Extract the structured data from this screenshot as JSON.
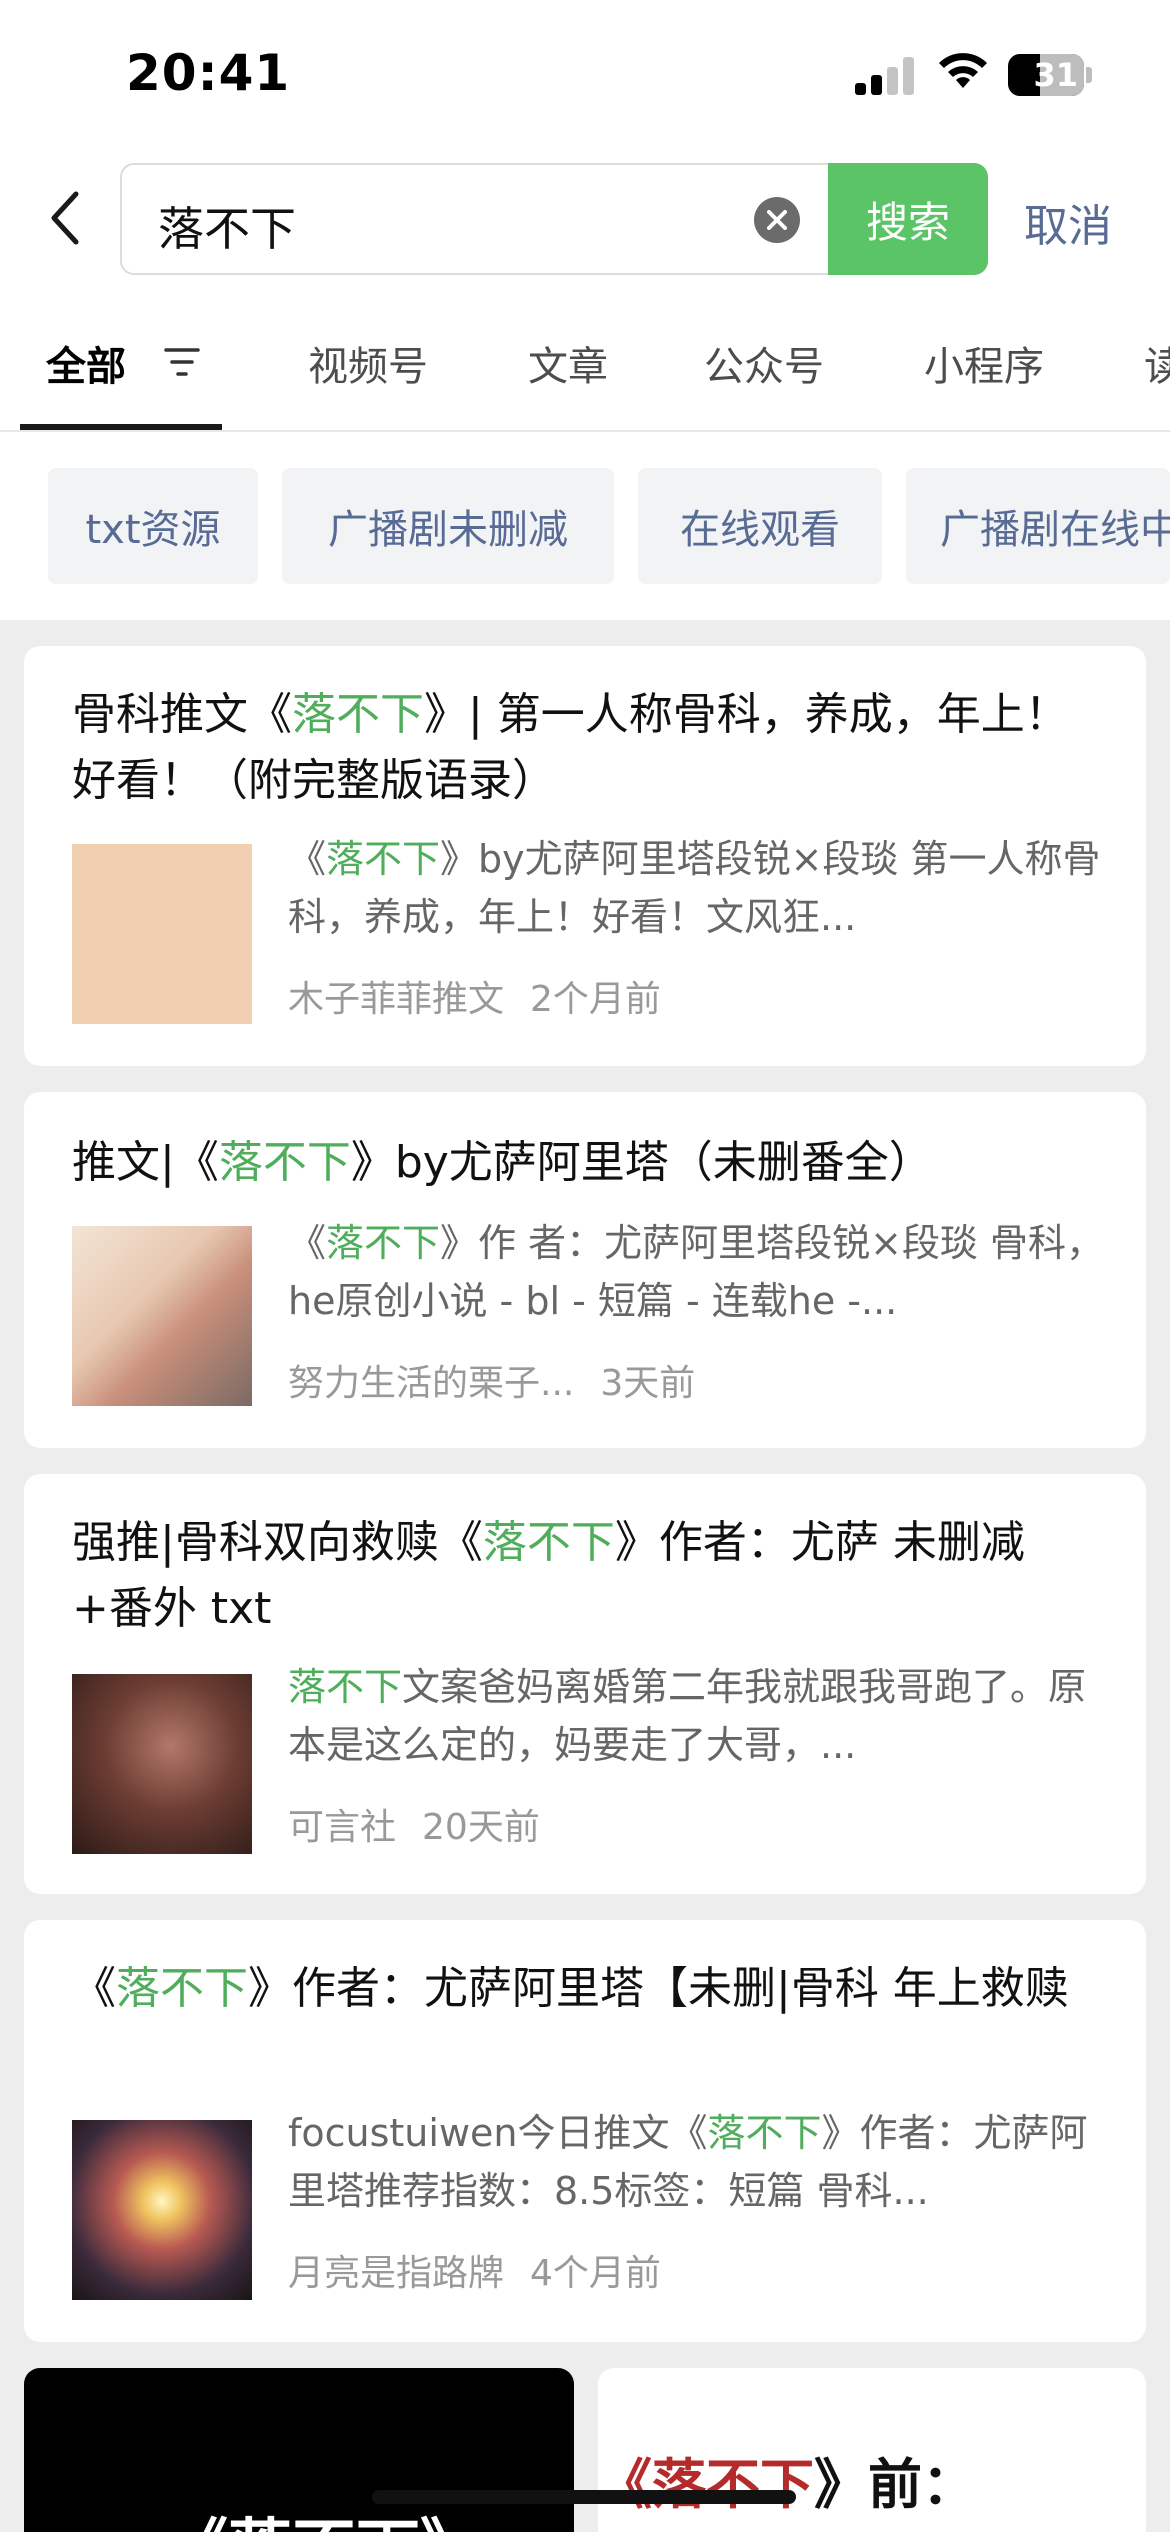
{
  "status_bar": {
    "time": "20:41",
    "battery": "31"
  },
  "search": {
    "query": "落不下",
    "button": "搜索",
    "cancel": "取消"
  },
  "tabs": [
    "全部",
    "视频号",
    "文章",
    "公众号",
    "小程序",
    "读"
  ],
  "chips": [
    "txt资源",
    "广播剧未删减",
    "在线观看",
    "广播剧在线中"
  ],
  "results": [
    {
      "title_pre": "骨科推文《",
      "title_hl": "落不下",
      "title_post": "》| 第一人称骨科，养成，年上！好看！（附完整版语录）",
      "snippet_pre": "《",
      "snippet_hl": "落不下",
      "snippet_post": "》by尤萨阿里塔段锐×段琰 第一人称骨科，养成，年上！好看！文风狂...",
      "source": "木子菲菲推文",
      "time": "2个月前",
      "thumb_color": "#f1d0b2"
    },
    {
      "title_pre": "推文|《",
      "title_hl": "落不下",
      "title_post": "》by尤萨阿里塔（未删番全）",
      "snippet_pre": "《",
      "snippet_hl": "落不下",
      "snippet_post": "》作 者：尤萨阿里塔段锐×段琰 骨科，he原创小说 - bl - 短篇 - 连载he -...",
      "source": "努力生活的栗子...",
      "time": "3天前",
      "thumb_color": "#e8d7c6"
    },
    {
      "title_pre": "强推|骨科双向救赎《",
      "title_hl": "落不下",
      "title_post": "》作者：尤萨 未删减+番外 txt",
      "snippet_pre": "",
      "snippet_hl": "落不下",
      "snippet_post": "文案爸妈离婚第二年我就跟我哥跑了。原本是这么定的，妈要走了大哥，...",
      "source": "可言社",
      "time": "20天前",
      "thumb_color": "#5a3226"
    },
    {
      "title_pre": "《",
      "title_hl": "落不下",
      "title_post": "》作者：尤萨阿里塔【未删|骨科 年上救赎",
      "snippet_pre": "focustuiwen今日推文《",
      "snippet_hl": "落不下",
      "snippet_post": "》作者：尤萨阿里塔推荐指数：8.5标签：短篇 骨科...",
      "source": "月亮是指路牌",
      "time": "4个月前",
      "thumb_color": "#2a1f22"
    }
  ],
  "bottom_cards": {
    "left_text": "《落不下》",
    "right_pre": "《",
    "right_hl": "落不下",
    "right_post": "》前："
  }
}
